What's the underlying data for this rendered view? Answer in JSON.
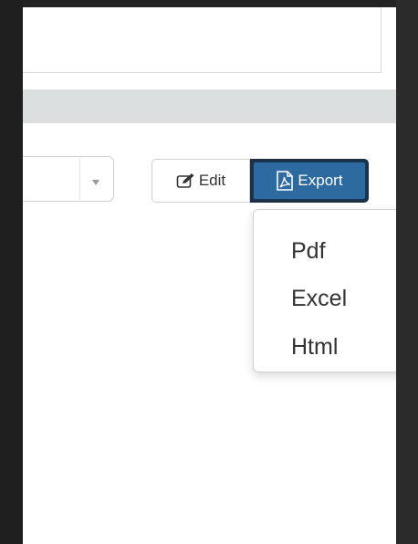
{
  "toolbar": {
    "edit_label": "Edit",
    "export_label": "Export",
    "edit_icon": "edit-icon",
    "export_icon": "pdf-file-icon"
  },
  "export_menu": {
    "items": [
      {
        "label": "Pdf"
      },
      {
        "label": "Excel"
      },
      {
        "label": "Html"
      }
    ]
  },
  "select": {
    "value": "",
    "caret_icon": "caret-down-icon"
  },
  "colors": {
    "accent": "#2c6aa0",
    "section_bar": "#dcdfdf"
  }
}
